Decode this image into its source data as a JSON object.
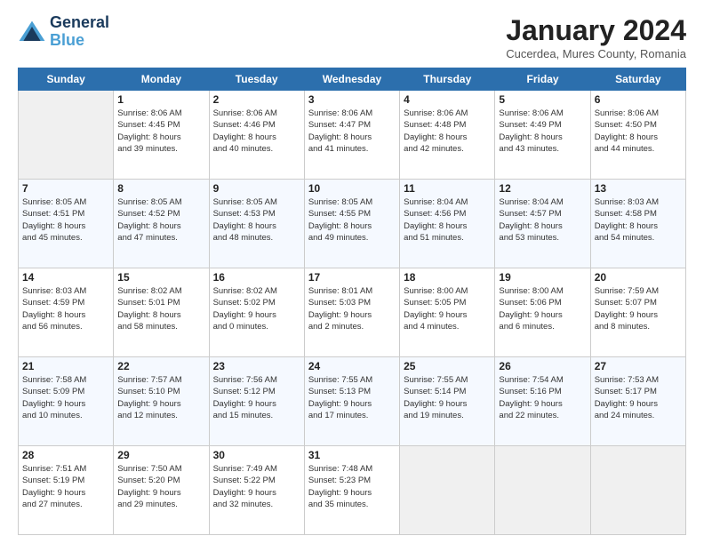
{
  "header": {
    "logo_line1": "General",
    "logo_line2": "Blue",
    "month_title": "January 2024",
    "subtitle": "Cucerdea, Mures County, Romania"
  },
  "weekdays": [
    "Sunday",
    "Monday",
    "Tuesday",
    "Wednesday",
    "Thursday",
    "Friday",
    "Saturday"
  ],
  "weeks": [
    [
      {
        "day": "",
        "info": ""
      },
      {
        "day": "1",
        "info": "Sunrise: 8:06 AM\nSunset: 4:45 PM\nDaylight: 8 hours\nand 39 minutes."
      },
      {
        "day": "2",
        "info": "Sunrise: 8:06 AM\nSunset: 4:46 PM\nDaylight: 8 hours\nand 40 minutes."
      },
      {
        "day": "3",
        "info": "Sunrise: 8:06 AM\nSunset: 4:47 PM\nDaylight: 8 hours\nand 41 minutes."
      },
      {
        "day": "4",
        "info": "Sunrise: 8:06 AM\nSunset: 4:48 PM\nDaylight: 8 hours\nand 42 minutes."
      },
      {
        "day": "5",
        "info": "Sunrise: 8:06 AM\nSunset: 4:49 PM\nDaylight: 8 hours\nand 43 minutes."
      },
      {
        "day": "6",
        "info": "Sunrise: 8:06 AM\nSunset: 4:50 PM\nDaylight: 8 hours\nand 44 minutes."
      }
    ],
    [
      {
        "day": "7",
        "info": "Sunrise: 8:05 AM\nSunset: 4:51 PM\nDaylight: 8 hours\nand 45 minutes."
      },
      {
        "day": "8",
        "info": "Sunrise: 8:05 AM\nSunset: 4:52 PM\nDaylight: 8 hours\nand 47 minutes."
      },
      {
        "day": "9",
        "info": "Sunrise: 8:05 AM\nSunset: 4:53 PM\nDaylight: 8 hours\nand 48 minutes."
      },
      {
        "day": "10",
        "info": "Sunrise: 8:05 AM\nSunset: 4:55 PM\nDaylight: 8 hours\nand 49 minutes."
      },
      {
        "day": "11",
        "info": "Sunrise: 8:04 AM\nSunset: 4:56 PM\nDaylight: 8 hours\nand 51 minutes."
      },
      {
        "day": "12",
        "info": "Sunrise: 8:04 AM\nSunset: 4:57 PM\nDaylight: 8 hours\nand 53 minutes."
      },
      {
        "day": "13",
        "info": "Sunrise: 8:03 AM\nSunset: 4:58 PM\nDaylight: 8 hours\nand 54 minutes."
      }
    ],
    [
      {
        "day": "14",
        "info": "Sunrise: 8:03 AM\nSunset: 4:59 PM\nDaylight: 8 hours\nand 56 minutes."
      },
      {
        "day": "15",
        "info": "Sunrise: 8:02 AM\nSunset: 5:01 PM\nDaylight: 8 hours\nand 58 minutes."
      },
      {
        "day": "16",
        "info": "Sunrise: 8:02 AM\nSunset: 5:02 PM\nDaylight: 9 hours\nand 0 minutes."
      },
      {
        "day": "17",
        "info": "Sunrise: 8:01 AM\nSunset: 5:03 PM\nDaylight: 9 hours\nand 2 minutes."
      },
      {
        "day": "18",
        "info": "Sunrise: 8:00 AM\nSunset: 5:05 PM\nDaylight: 9 hours\nand 4 minutes."
      },
      {
        "day": "19",
        "info": "Sunrise: 8:00 AM\nSunset: 5:06 PM\nDaylight: 9 hours\nand 6 minutes."
      },
      {
        "day": "20",
        "info": "Sunrise: 7:59 AM\nSunset: 5:07 PM\nDaylight: 9 hours\nand 8 minutes."
      }
    ],
    [
      {
        "day": "21",
        "info": "Sunrise: 7:58 AM\nSunset: 5:09 PM\nDaylight: 9 hours\nand 10 minutes."
      },
      {
        "day": "22",
        "info": "Sunrise: 7:57 AM\nSunset: 5:10 PM\nDaylight: 9 hours\nand 12 minutes."
      },
      {
        "day": "23",
        "info": "Sunrise: 7:56 AM\nSunset: 5:12 PM\nDaylight: 9 hours\nand 15 minutes."
      },
      {
        "day": "24",
        "info": "Sunrise: 7:55 AM\nSunset: 5:13 PM\nDaylight: 9 hours\nand 17 minutes."
      },
      {
        "day": "25",
        "info": "Sunrise: 7:55 AM\nSunset: 5:14 PM\nDaylight: 9 hours\nand 19 minutes."
      },
      {
        "day": "26",
        "info": "Sunrise: 7:54 AM\nSunset: 5:16 PM\nDaylight: 9 hours\nand 22 minutes."
      },
      {
        "day": "27",
        "info": "Sunrise: 7:53 AM\nSunset: 5:17 PM\nDaylight: 9 hours\nand 24 minutes."
      }
    ],
    [
      {
        "day": "28",
        "info": "Sunrise: 7:51 AM\nSunset: 5:19 PM\nDaylight: 9 hours\nand 27 minutes."
      },
      {
        "day": "29",
        "info": "Sunrise: 7:50 AM\nSunset: 5:20 PM\nDaylight: 9 hours\nand 29 minutes."
      },
      {
        "day": "30",
        "info": "Sunrise: 7:49 AM\nSunset: 5:22 PM\nDaylight: 9 hours\nand 32 minutes."
      },
      {
        "day": "31",
        "info": "Sunrise: 7:48 AM\nSunset: 5:23 PM\nDaylight: 9 hours\nand 35 minutes."
      },
      {
        "day": "",
        "info": ""
      },
      {
        "day": "",
        "info": ""
      },
      {
        "day": "",
        "info": ""
      }
    ]
  ]
}
